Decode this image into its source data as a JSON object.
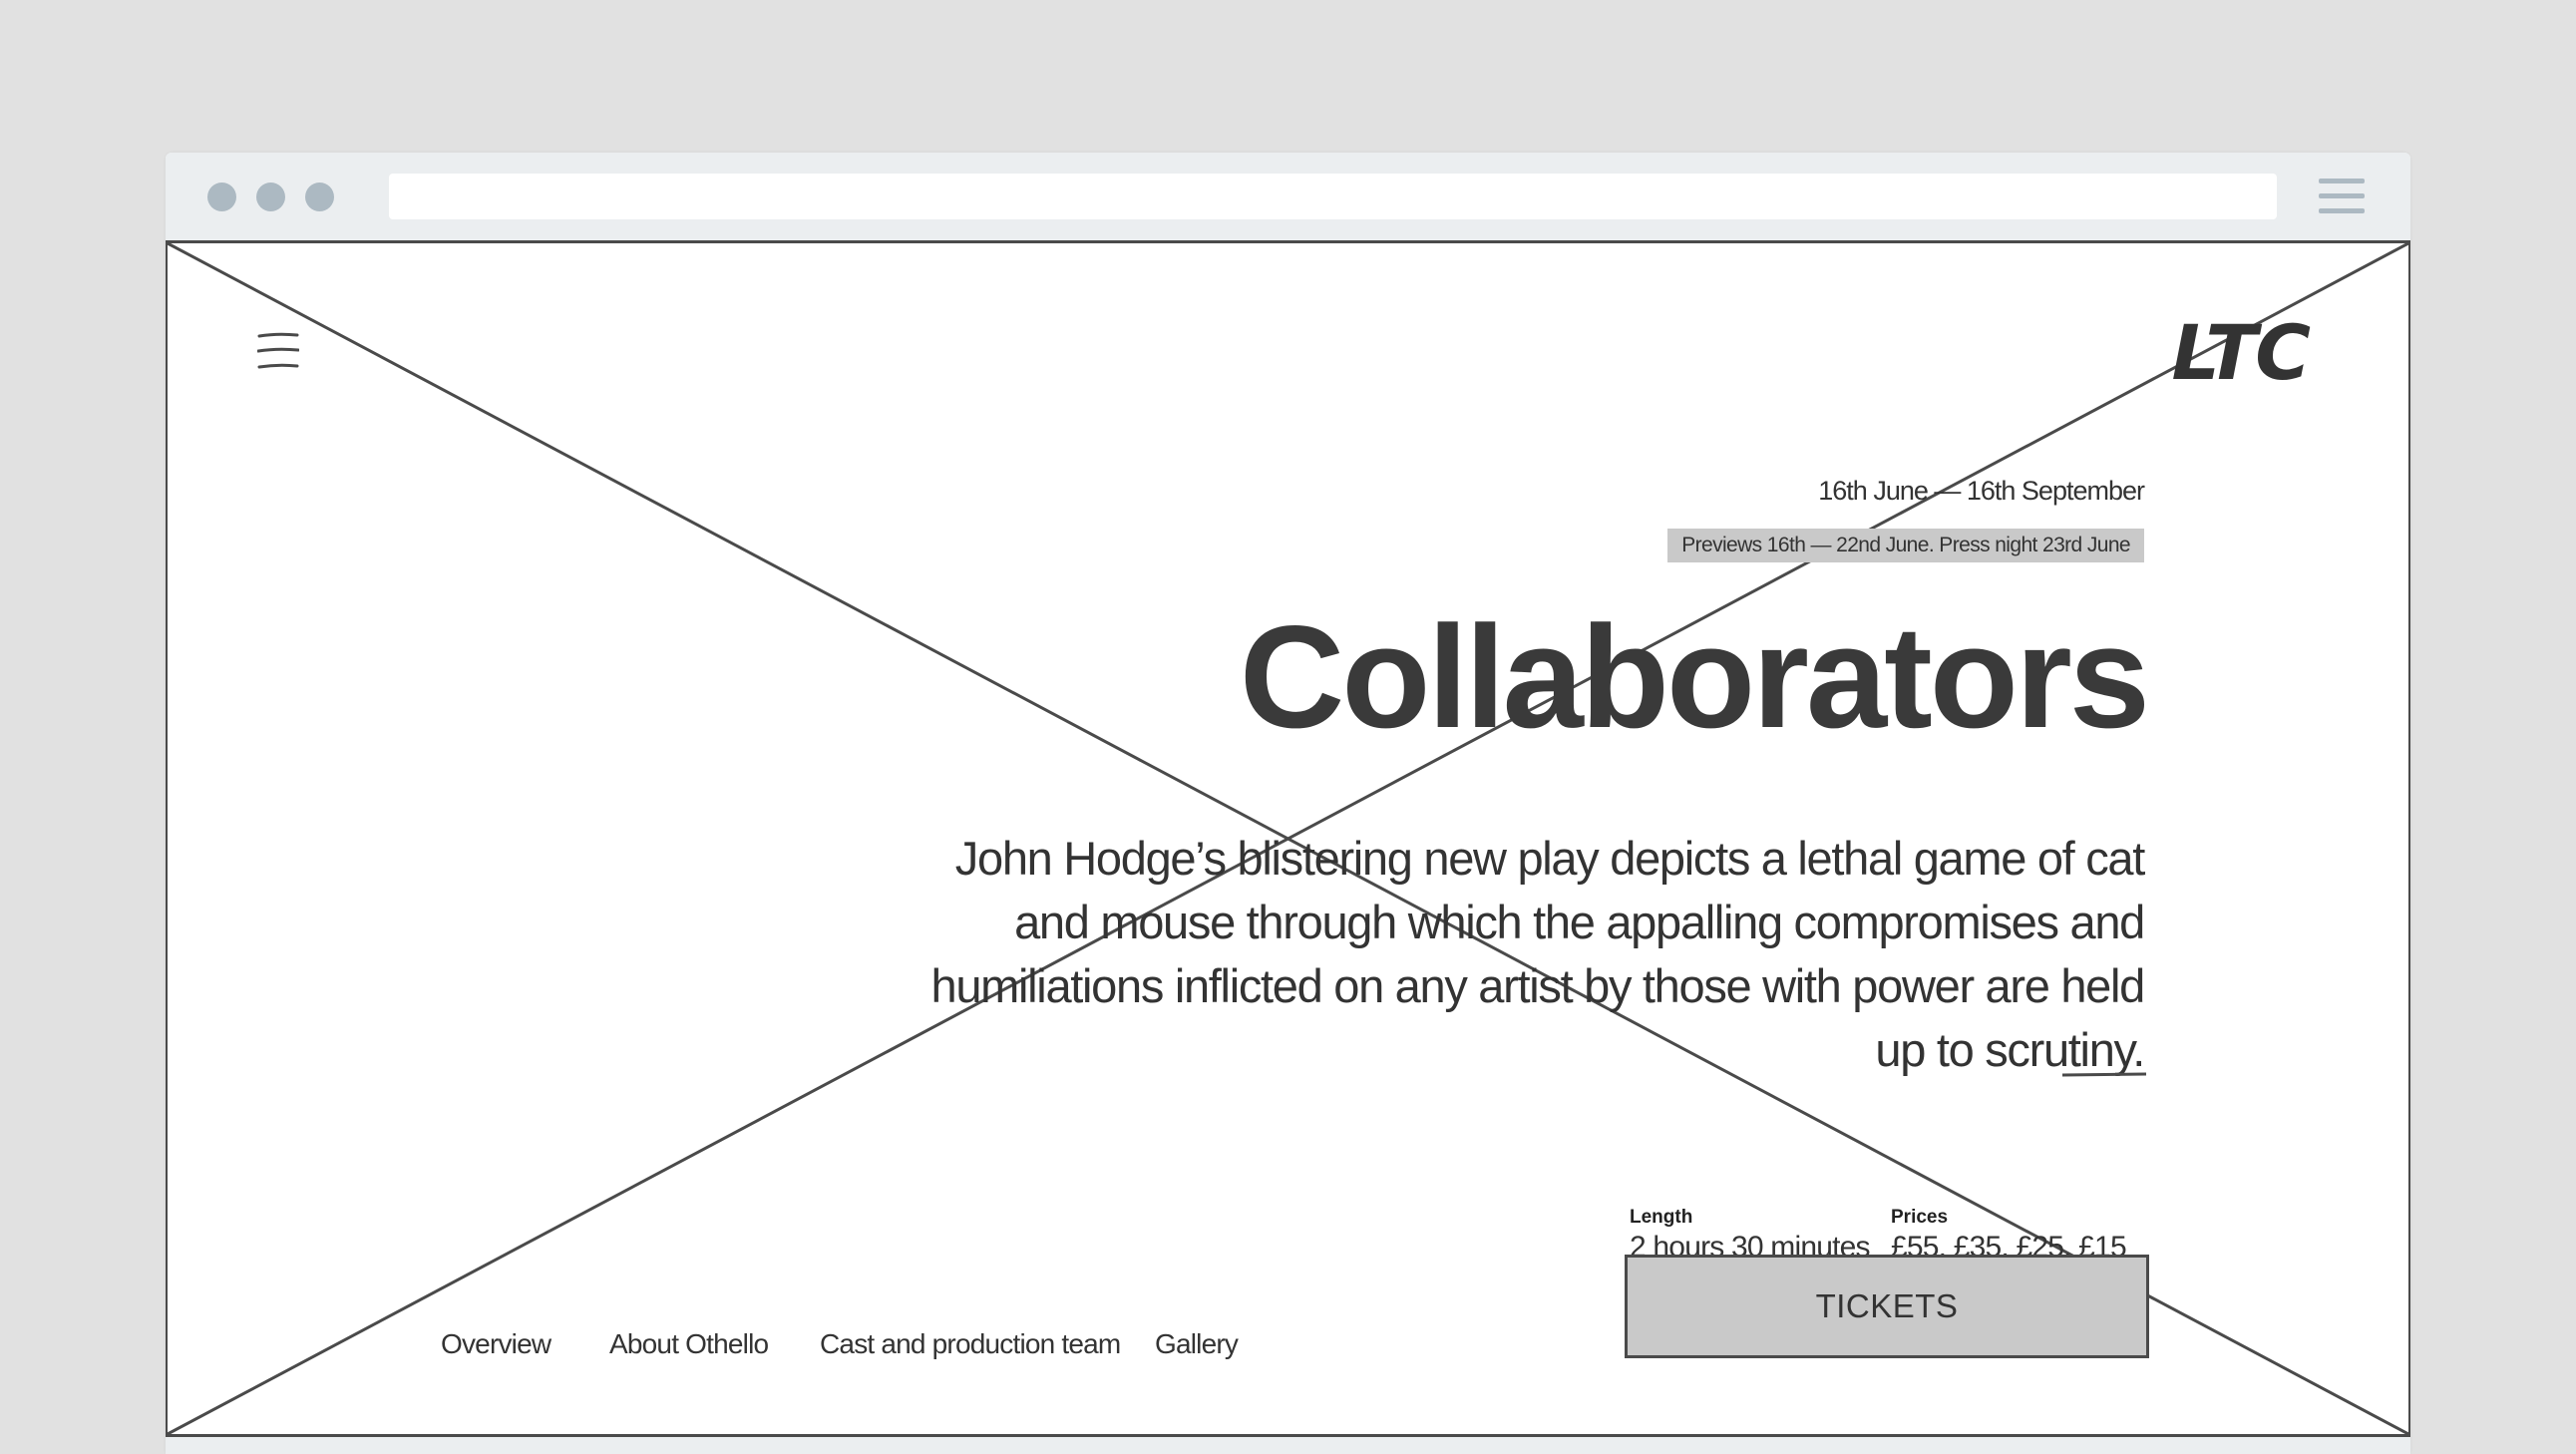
{
  "browser": {
    "address": "",
    "window_dots": [
      "close-dot",
      "minimize-dot",
      "maximize-dot"
    ],
    "menu_icon": "hamburger-icon"
  },
  "site": {
    "logo": "LTC",
    "menu_icon": "hamburger-icon"
  },
  "hero": {
    "dates": "16th June — 16th September",
    "previews": "Previews 16th — 22nd June. Press night 23rd June",
    "title": "Collaborators",
    "description": "John Hodge’s blistering new play depicts a lethal game of cat and mouse through which the appalling compromises and humiliations inflicted on any artist by those with power are held up to scrutiny."
  },
  "details": {
    "length_label": "Length",
    "length_value": "2 hours 30 minutes",
    "prices_label": "Prices",
    "prices_value": "£55, £35, £25, £15"
  },
  "cta": {
    "tickets_label": "TICKETS"
  },
  "subnav": {
    "items": [
      {
        "label": "Overview"
      },
      {
        "label": "About Othello"
      },
      {
        "label": "Cast and production team"
      },
      {
        "label": "Gallery"
      }
    ]
  },
  "colors": {
    "page_bg": "#e1e1e1",
    "chrome_bg": "#ebeef0",
    "chrome_accent": "#acb9c2",
    "ink": "#333333",
    "highlight_bg": "#c9c9c9"
  }
}
